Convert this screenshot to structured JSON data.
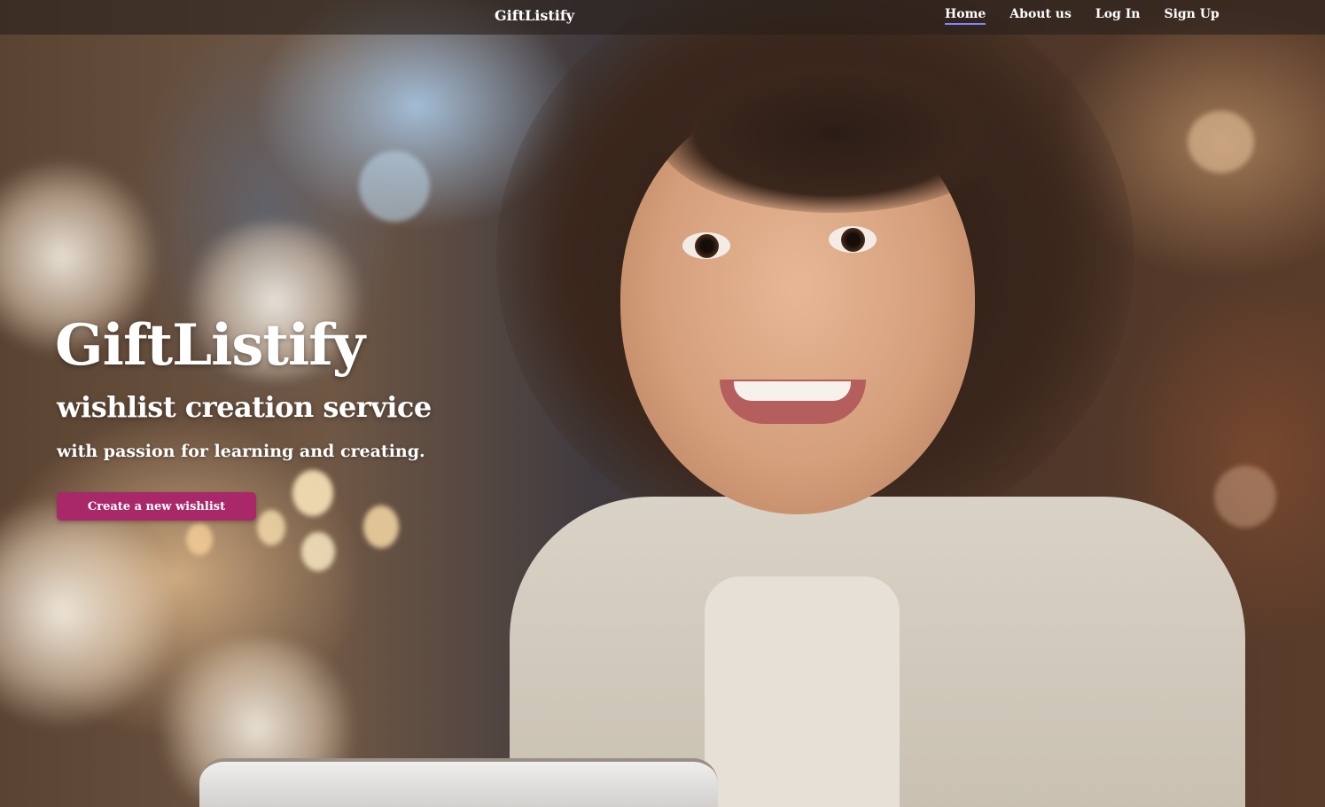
{
  "nav": {
    "brand": "GiftListify",
    "links": [
      {
        "label": "Home",
        "active": true
      },
      {
        "label": "About us",
        "active": false
      },
      {
        "label": "Log In",
        "active": false
      },
      {
        "label": "Sign Up",
        "active": false
      }
    ]
  },
  "hero": {
    "title": "GiftListify",
    "subtitle": "wishlist creation service",
    "tagline": "with passion for learning and creating.",
    "cta_label": "Create a new wishlist"
  },
  "colors": {
    "accent": "#a8286a",
    "nav_active_underline": "#7d86ff",
    "nav_background": "rgba(40,32,28,0.62)"
  }
}
